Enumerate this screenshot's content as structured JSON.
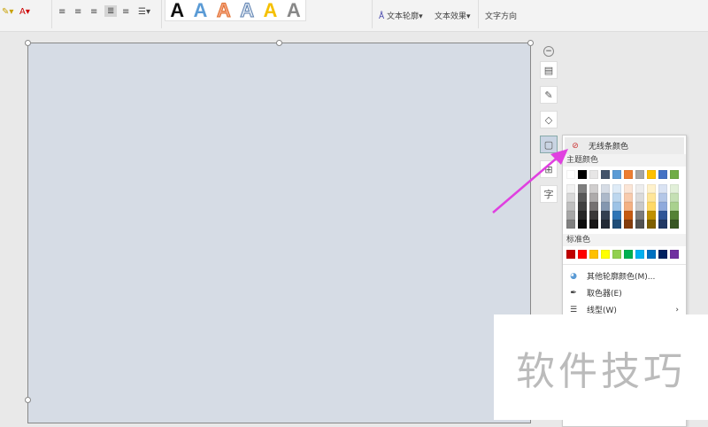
{
  "ribbon": {
    "gallery": [
      {
        "t": "A",
        "c": "#111111"
      },
      {
        "t": "A",
        "c": "#5b9bd5"
      },
      {
        "t": "A",
        "c": "#f4a582"
      },
      {
        "t": "A",
        "c": "#dde6f0"
      },
      {
        "t": "A",
        "c": "#f5c000"
      },
      {
        "t": "A",
        "c": "#888888"
      }
    ],
    "text_outline": "文本轮廓",
    "text_effect": "文本效果",
    "text_direction": "文字方向"
  },
  "side_tools": [
    "layout-icon",
    "pen-icon",
    "fill-icon",
    "outline-icon",
    "wrap-icon",
    "text-icon"
  ],
  "side_text_label": "字",
  "menu": {
    "no_line": "无线条颜色",
    "theme_label": "主题颜色",
    "theme": [
      "#ffffff",
      "#000000",
      "#e7e6e6",
      "#44546a",
      "#5b9bd5",
      "#ed7d31",
      "#a5a5a5",
      "#ffc000",
      "#4472c4",
      "#70ad47"
    ],
    "shades": [
      [
        "#f2f2f2",
        "#d9d9d9",
        "#bfbfbf",
        "#a6a6a6",
        "#808080"
      ],
      [
        "#7f7f7f",
        "#595959",
        "#404040",
        "#262626",
        "#0d0d0d"
      ],
      [
        "#d0cece",
        "#aeabab",
        "#757171",
        "#3a3838",
        "#171616"
      ],
      [
        "#d6dce5",
        "#adb9ca",
        "#8497b0",
        "#333f50",
        "#222a35"
      ],
      [
        "#deebf7",
        "#bdd7ee",
        "#9dc3e6",
        "#2e75b6",
        "#1f4e79"
      ],
      [
        "#fbe5d6",
        "#f8cbad",
        "#f4b183",
        "#c55a11",
        "#843c0c"
      ],
      [
        "#ededed",
        "#dbdbdb",
        "#c9c9c9",
        "#7b7b7b",
        "#525252"
      ],
      [
        "#fff2cc",
        "#ffe699",
        "#ffd966",
        "#bf9000",
        "#7f6000"
      ],
      [
        "#dae3f3",
        "#b4c7e7",
        "#8faadc",
        "#2f5597",
        "#203864"
      ],
      [
        "#e2f0d9",
        "#c5e0b4",
        "#a9d18e",
        "#548235",
        "#385723"
      ]
    ],
    "standard_label": "标准色",
    "standard": [
      "#c00000",
      "#ff0000",
      "#ffc000",
      "#ffff00",
      "#92d050",
      "#00b050",
      "#00b0f0",
      "#0070c0",
      "#002060",
      "#7030a0"
    ],
    "more": "其他轮廓颜色(M)...",
    "picker": "取色器(E)",
    "line_type": "线型(W)"
  },
  "watermark": "软件技巧",
  "arrow_color": "#e040e0"
}
